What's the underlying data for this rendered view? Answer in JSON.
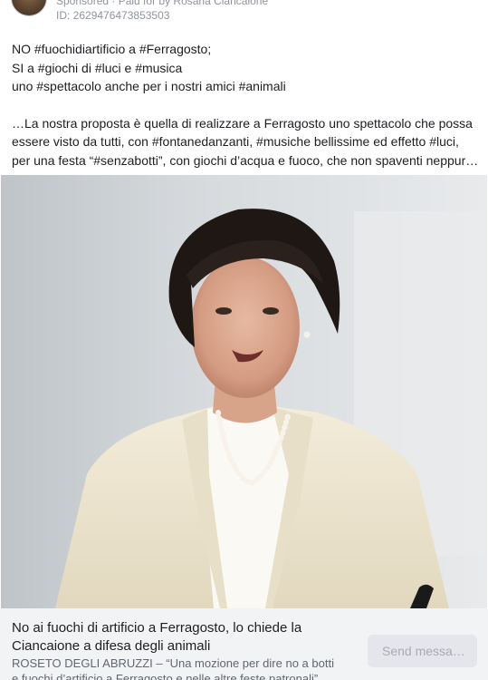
{
  "header": {
    "sponsor_line": "Sponsored · Paid for by Rosaria Ciancaione",
    "post_id": "ID: 2629476473853503"
  },
  "post": {
    "lines": [
      "NO #fuochidiartificio a #Ferragosto;",
      "SI a #giochi di #luci e #musica",
      "uno #spettacolo anche per i nostri amici #animali",
      "",
      "…La nostra proposta è quella di realizzare a Ferragosto uno spettacolo che possa",
      "essere visto da tutti, con #fontanedanzanti, #musiche bellissime ed effetto #luci,",
      "per una festa “#senzabotti”, con giochi d’acqua e fuoco, che non spaventi neppur…"
    ]
  },
  "link": {
    "title": "No ai fuochi di artificio a Ferragosto, lo chiede la Ciancaione a difesa degli animali",
    "desc_line1": "ROSETO DEGLI ABRUZZI – “Una mozione per dire no a botti",
    "desc_line2": "e fuochi d’artificio a Ferragosto e nelle altre feste patronali”",
    "send_label": "Send messa…"
  }
}
